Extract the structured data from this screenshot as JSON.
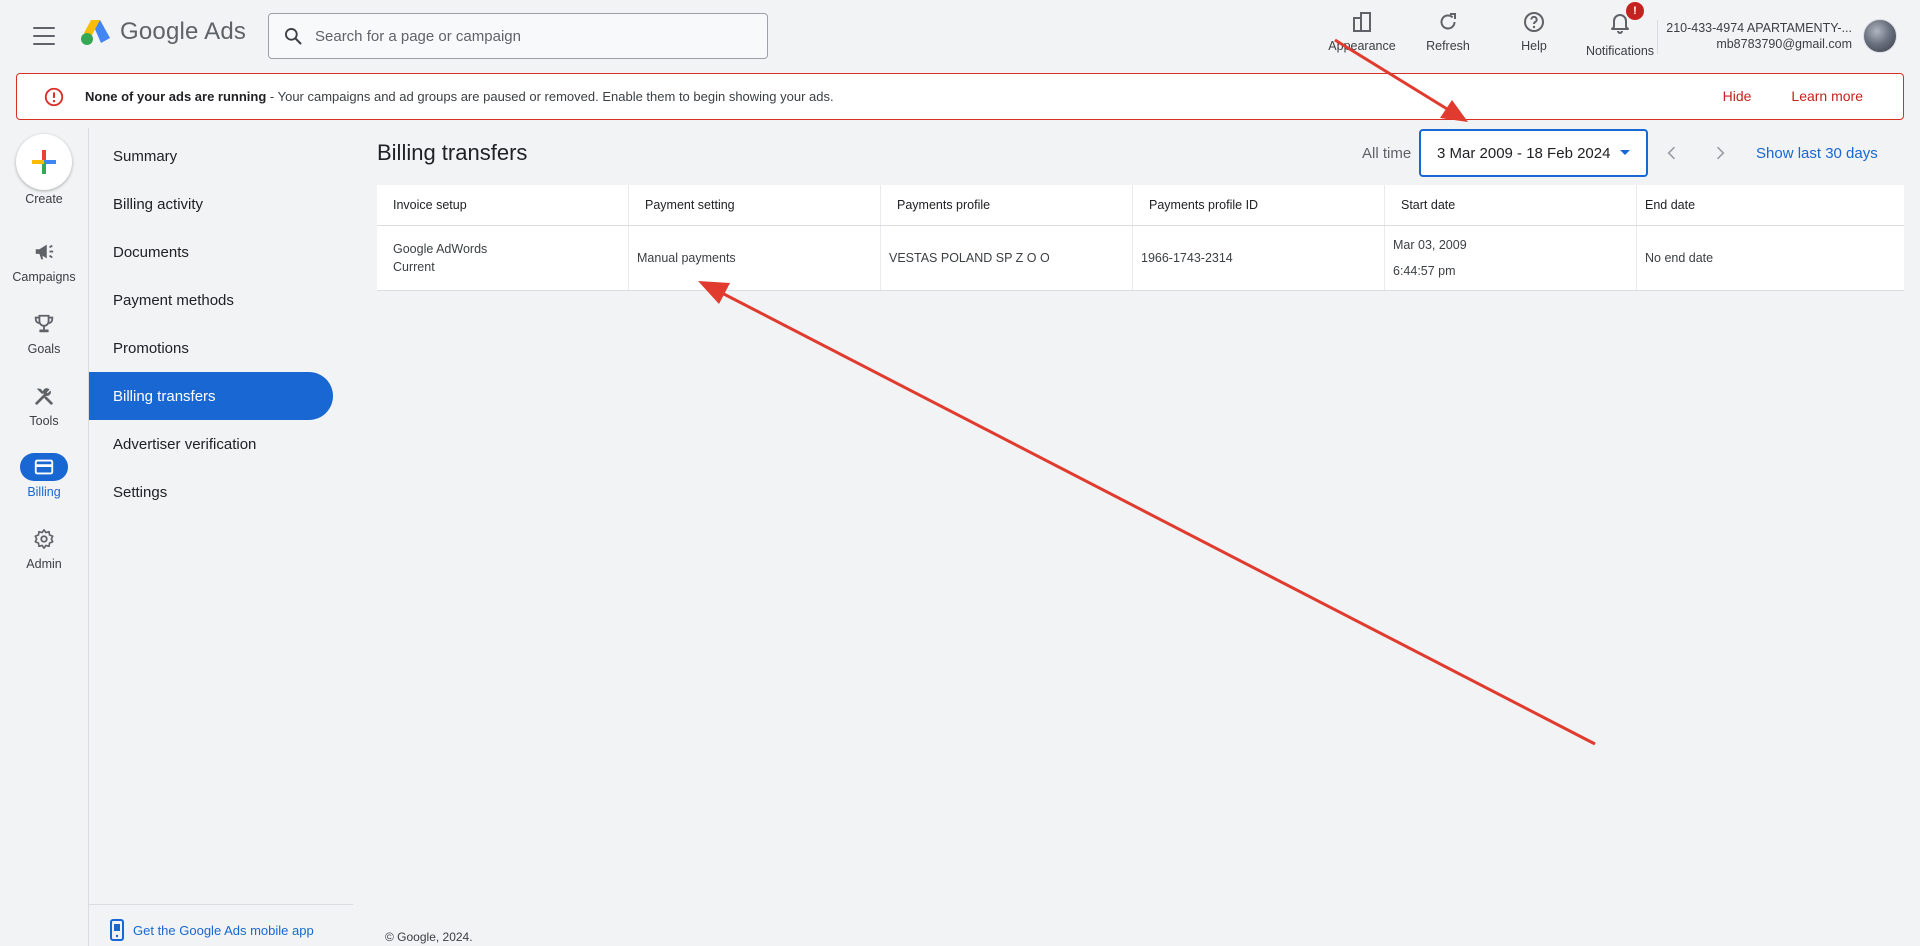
{
  "header": {
    "logo_text": "Google Ads",
    "search_placeholder": "Search for a page or campaign",
    "actions": [
      {
        "label": "Appearance",
        "icon": "appearance-icon"
      },
      {
        "label": "Refresh",
        "icon": "refresh-icon"
      },
      {
        "label": "Help",
        "icon": "help-icon"
      },
      {
        "label": "Notifications",
        "icon": "bell-icon",
        "badge": "!"
      }
    ],
    "account_name": "210-433-4974 APARTAMENTY-...",
    "account_email": "mb8783790@gmail.com"
  },
  "banner": {
    "title": "None of your ads are running",
    "message": " - Your campaigns and ad groups are paused or removed. Enable them to begin showing your ads.",
    "hide_label": "Hide",
    "learn_more_label": "Learn more",
    "color": "#d93025"
  },
  "rail": {
    "create_label": "Create",
    "items": [
      {
        "label": "Campaigns",
        "icon": "megaphone-icon"
      },
      {
        "label": "Goals",
        "icon": "trophy-icon"
      },
      {
        "label": "Tools",
        "icon": "tools-icon"
      },
      {
        "label": "Billing",
        "icon": "billing-card-icon",
        "active": true
      },
      {
        "label": "Admin",
        "icon": "gear-icon"
      }
    ]
  },
  "nav": {
    "items": [
      {
        "label": "Summary"
      },
      {
        "label": "Billing activity"
      },
      {
        "label": "Documents"
      },
      {
        "label": "Payment methods"
      },
      {
        "label": "Promotions"
      },
      {
        "label": "Billing transfers",
        "active": true
      },
      {
        "label": "Advertiser verification"
      },
      {
        "label": "Settings"
      }
    ],
    "mobile_app_label": "Get the Google Ads mobile app"
  },
  "main": {
    "title": "Billing transfers",
    "range_label": "All time",
    "date_range": "3 Mar 2009 - 18 Feb 2024",
    "show_last_label": "Show last 30 days",
    "table": {
      "headers": [
        "Invoice setup",
        "Payment setting",
        "Payments profile",
        "Payments profile ID",
        "Start date",
        "End date"
      ],
      "rows": [
        {
          "invoice_setup_line1": "Google AdWords",
          "invoice_setup_line2": "Current",
          "payment_setting": "Manual payments",
          "payments_profile": "VESTAS POLAND SP Z O O",
          "payments_profile_id": "1966-1743-2314",
          "start_date": "Mar 03, 2009",
          "start_time": "6:44:57 pm",
          "end_date": "No end date"
        }
      ]
    }
  },
  "footer": {
    "copyright": "© Google, 2024."
  },
  "colors": {
    "accent": "#1967d2",
    "alert": "#d93025",
    "annotation_arrow": "#e03b2e"
  }
}
